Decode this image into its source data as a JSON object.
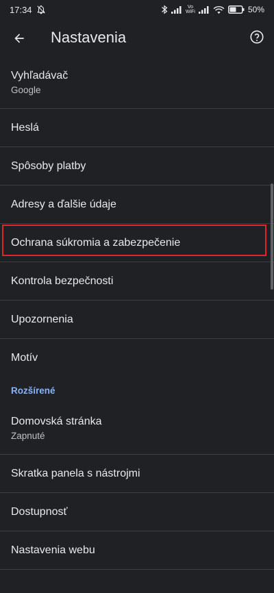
{
  "status_bar": {
    "time": "17:34",
    "volte_top": "Vo",
    "volte_bottom": "WiFi",
    "battery": "50%"
  },
  "app_bar": {
    "title": "Nastavenia"
  },
  "settings": {
    "search_engine": {
      "title": "Vyhľadávač",
      "summary": "Google"
    },
    "passwords": {
      "title": "Heslá"
    },
    "payment_methods": {
      "title": "Spôsoby platby"
    },
    "addresses": {
      "title": "Adresy a ďalšie údaje"
    },
    "privacy_security": {
      "title": "Ochrana súkromia a zabezpečenie"
    },
    "safety_check": {
      "title": "Kontrola bezpečnosti"
    },
    "notifications": {
      "title": "Upozornenia"
    },
    "theme": {
      "title": "Motív"
    },
    "advanced_header": "Rozšírené",
    "homepage": {
      "title": "Domovská stránka",
      "summary": "Zapnuté"
    },
    "toolbar_shortcut": {
      "title": "Skratka panela s nástrojmi"
    },
    "accessibility": {
      "title": "Dostupnosť"
    },
    "site_settings": {
      "title": "Nastavenia webu"
    }
  },
  "colors": {
    "background": "#202124",
    "text": "#e8eaed",
    "secondary_text": "#bdc1c6",
    "accent": "#8ab4f8",
    "highlight": "#e0262d",
    "divider": "#3c4043"
  }
}
